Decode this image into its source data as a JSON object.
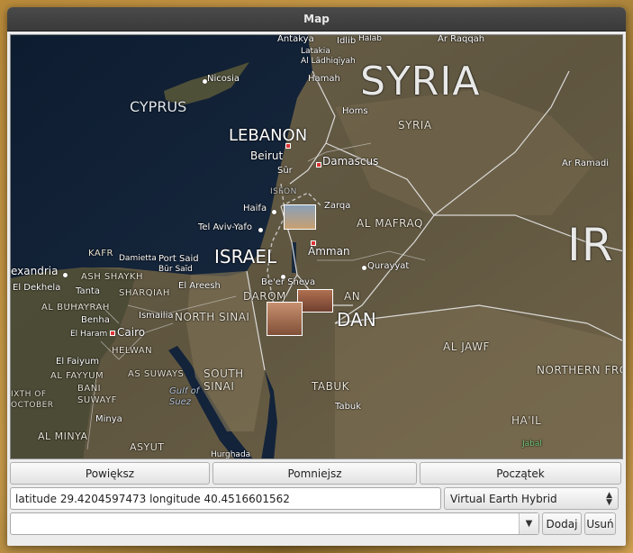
{
  "window": {
    "title": "Map"
  },
  "map": {
    "labels": {
      "syria": "SYRIA",
      "syria_small": "SYRIA",
      "iraq_partial": "IR",
      "cyprus": "CYPRUS",
      "lebanon": "LEBANON",
      "israel": "ISRAEL",
      "jordan_partial": "DAN",
      "jordan_small": "AN",
      "nicosia": "Nicosia",
      "beirut": "Beirut",
      "damascus": "Damascus",
      "haifa": "Haifa",
      "tel_aviv": "Tel Aviv-Yafo",
      "amman": "Amman",
      "zarqa": "Zarqa",
      "al_mafraq": "AL MAFRAQ",
      "qurayyat": "Qurayyat",
      "beer_sheva": "Be'er Sheva",
      "daroma": "DAROM",
      "north_sinai": "NORTH SINAI",
      "south_sinai": "SOUTH SINAI",
      "gulf_suez": "Gulf of Suez",
      "cairo": "Cairo",
      "alexandria": "exandria",
      "el_dekhela": "El Dekhela",
      "kafr": "KAFR",
      "ash_shaykh": "ASH SHAYKH",
      "tanta": "Tanta",
      "damietta": "Damietta",
      "port_said": "Port Said",
      "bur_said": "Būr Saīd",
      "sharqia": "SHARQIAH",
      "al_buhayrah": "AL BUHAYRAH",
      "benha": "Benha",
      "ismailia": "Ismailia",
      "el_arish": "El Areesh",
      "el_haram": "El Haram",
      "helwan": "HELWAN",
      "el_faiyum": "El Faiyum",
      "al_fayyum": "AL FAYYUM",
      "as_suways": "AS SUWAYS",
      "bani_suwayf": "BANI SUWAYF",
      "sixth_oct": "IXTH OF OCTOBER",
      "minya": "Minya",
      "al_minya": "AL MINYA",
      "asyut": "ASYUT",
      "hurghada": "Hurghada",
      "tabuk_region": "TABUK",
      "tabuk": "Tabuk",
      "hail_region": "HA'IL",
      "jabal": "Jabal",
      "al_jawf": "AL JAWF",
      "northern_fro": "NORTHERN FRO",
      "ar_ramadi": "Ar Ramadi",
      "homs": "Homs",
      "hamah": "Hamah",
      "latakia": "Latakia",
      "al_ladhiqiyah": "Al Lādhiqīyah",
      "antakya": "Antakya",
      "idlib": "Idlib",
      "halab": "Halab",
      "ar_raqqah": "Ar Raqqah",
      "sur": "Sūr",
      "isfon": "ISFON"
    }
  },
  "toolbar": {
    "zoom_in": "Powiększ",
    "zoom_out": "Pomniejsz",
    "home": "Początek"
  },
  "coords": {
    "text": "latitude 29.4204597473 longitude 40.4516601562"
  },
  "map_type": {
    "selected": "Virtual Earth Hybrid"
  },
  "bookmarks": {
    "value": "",
    "add": "Dodaj",
    "remove": "Usuń"
  }
}
